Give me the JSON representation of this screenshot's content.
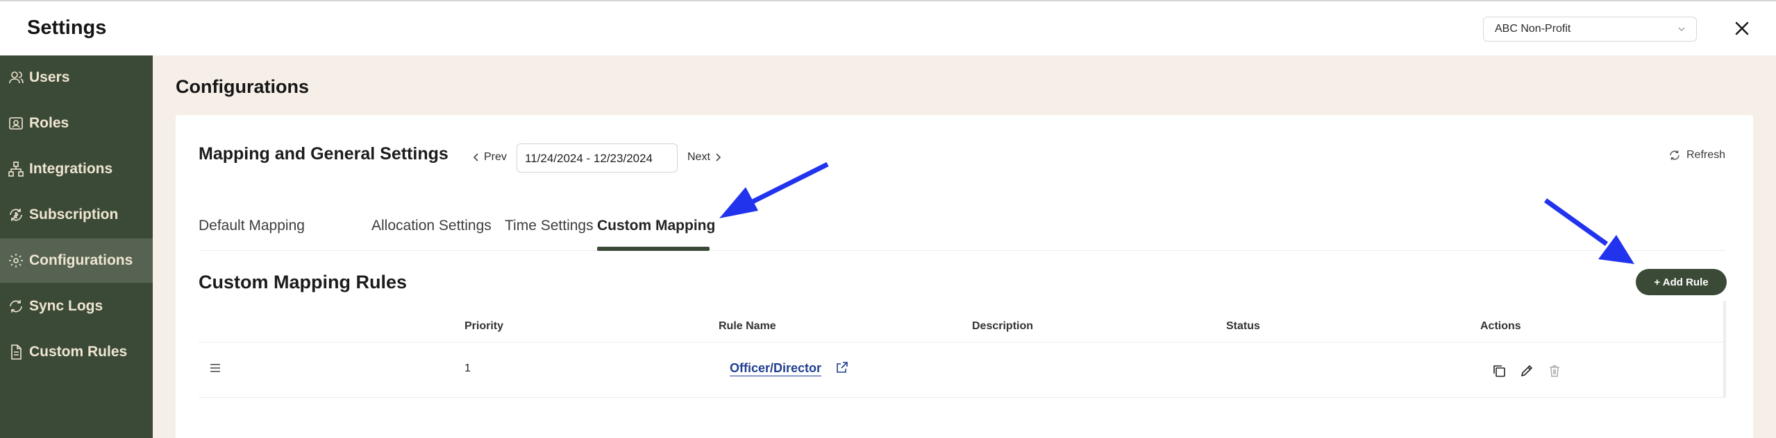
{
  "header": {
    "title": "Settings",
    "org_select": {
      "value": "ABC Non-Profit",
      "chevron_icon": "chevron-down-icon"
    },
    "close_icon": "close-icon"
  },
  "sidebar": {
    "items": [
      {
        "label": "Users",
        "icon": "users-icon",
        "active": false
      },
      {
        "label": "Roles",
        "icon": "roles-icon",
        "active": false
      },
      {
        "label": "Integrations",
        "icon": "integrations-icon",
        "active": false
      },
      {
        "label": "Subscription",
        "icon": "subscription-icon",
        "active": false
      },
      {
        "label": "Configurations",
        "icon": "gear-icon",
        "active": true
      },
      {
        "label": "Sync Logs",
        "icon": "sync-icon",
        "active": false
      },
      {
        "label": "Custom Rules",
        "icon": "document-icon",
        "active": false
      }
    ]
  },
  "main": {
    "page_title": "Configurations",
    "section_title": "Mapping and General Settings",
    "date_nav": {
      "prev_label": "Prev",
      "date_range": "11/24/2024 - 12/23/2024",
      "next_label": "Next"
    },
    "refresh_label": "Refresh",
    "tabs": [
      {
        "label": "Default Mapping",
        "active": false
      },
      {
        "label": "Allocation Settings",
        "active": false
      },
      {
        "label": "Time Settings",
        "active": false
      },
      {
        "label": "Custom Mapping",
        "active": true
      }
    ],
    "rules_title": "Custom Mapping Rules",
    "add_rule_label": "+ Add Rule",
    "table": {
      "columns": [
        "Priority",
        "Rule Name",
        "Description",
        "Status",
        "Actions"
      ],
      "rows": [
        {
          "priority": "1",
          "rule_name": "Officer/Director",
          "description": "",
          "status": ""
        }
      ]
    }
  },
  "colors": {
    "sidebar_bg": "#3b4a37",
    "sidebar_active": "#566352",
    "sidebar_text": "#efe6d2",
    "main_bg": "#f6efe8",
    "link": "#1f3f8f",
    "annotation_arrow": "#2233ee"
  }
}
